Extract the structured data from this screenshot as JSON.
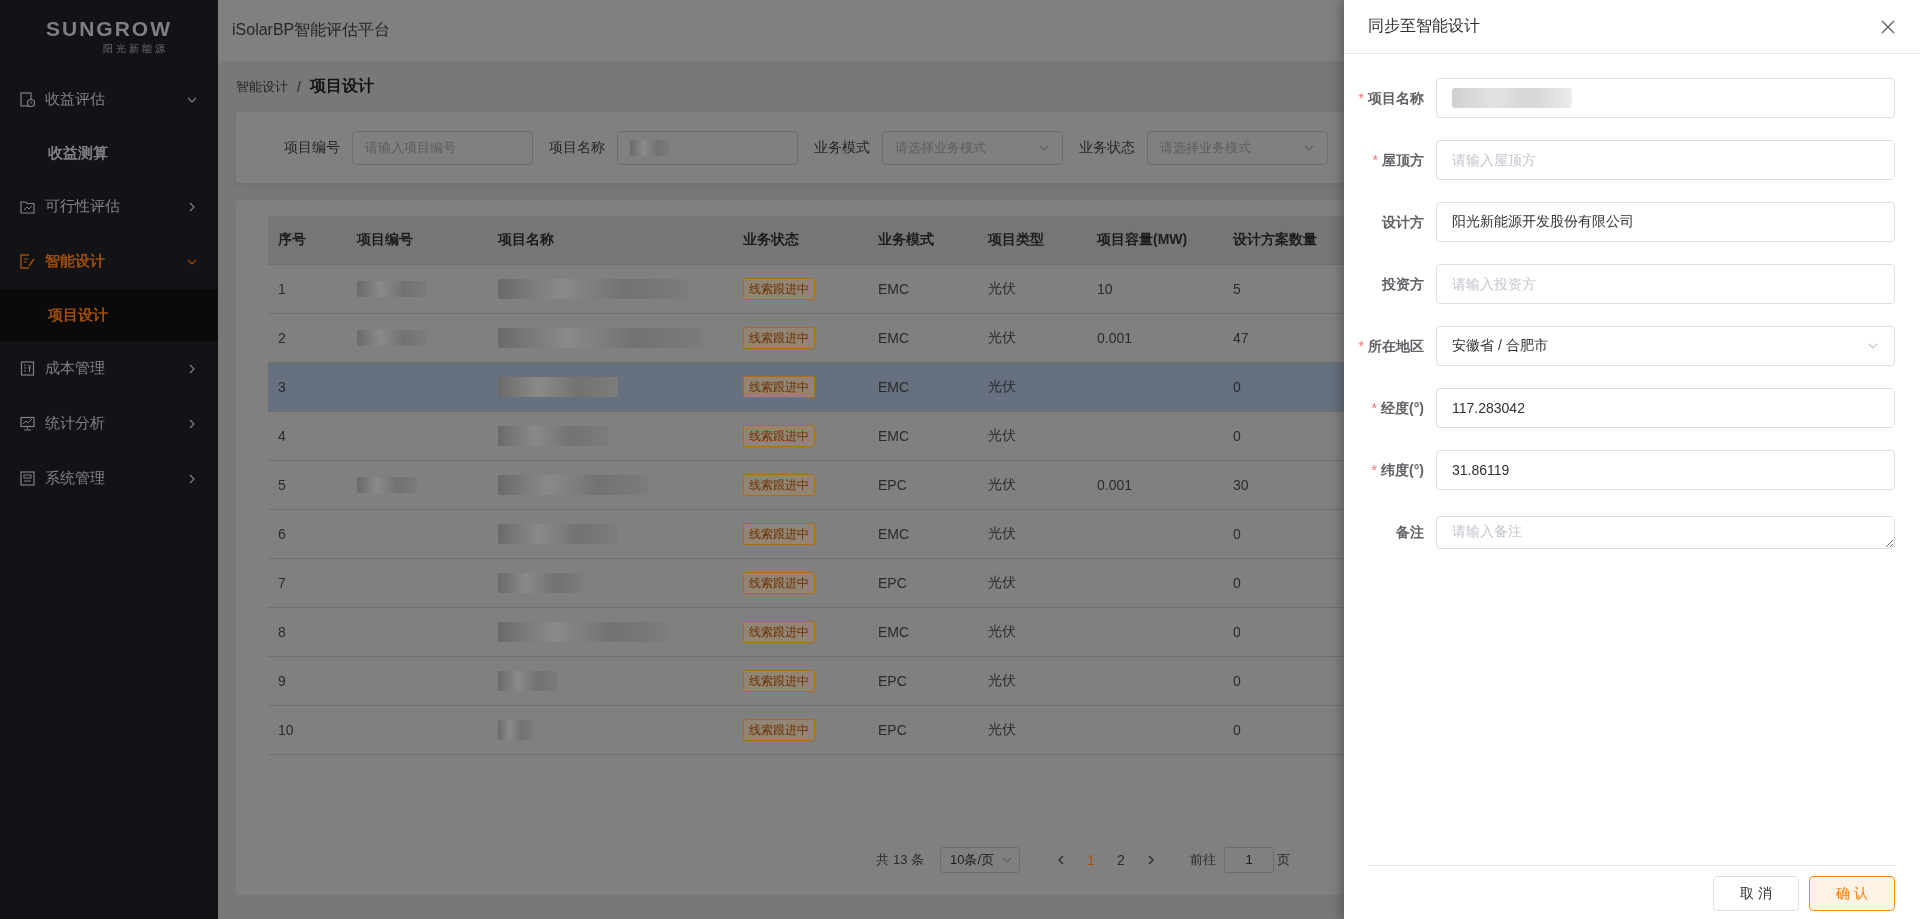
{
  "app": {
    "logo": "SUNGROW",
    "logo_subtitle": "阳光新能源",
    "title": "iSolarBP智能评估平台"
  },
  "sidebar": {
    "items": [
      {
        "label": "收益评估",
        "expanded": true,
        "selected": false,
        "children": [
          {
            "label": "收益测算",
            "selected": false
          }
        ]
      },
      {
        "label": "可行性评估",
        "expanded": false,
        "selected": false
      },
      {
        "label": "智能设计",
        "expanded": true,
        "selected": true,
        "children": [
          {
            "label": "项目设计",
            "selected": true
          }
        ]
      },
      {
        "label": "成本管理",
        "expanded": false,
        "selected": false
      },
      {
        "label": "统计分析",
        "expanded": false,
        "selected": false
      },
      {
        "label": "系统管理",
        "expanded": false,
        "selected": false
      }
    ]
  },
  "breadcrumb": {
    "items": [
      "智能设计",
      "项目设计"
    ],
    "separator": "/"
  },
  "filters": [
    {
      "label": "项目编号",
      "kind": "input",
      "placeholder": "请输入项目编号",
      "redacted": false
    },
    {
      "label": "项目名称",
      "kind": "input",
      "redacted": true
    },
    {
      "label": "业务模式",
      "kind": "select",
      "placeholder": "请选择业务模式",
      "redacted": false
    },
    {
      "label": "业务状态",
      "kind": "select",
      "placeholder": "请选择业务模式",
      "redacted": false
    }
  ],
  "table": {
    "columns": [
      "序号",
      "项目编号",
      "项目名称",
      "业务状态",
      "业务模式",
      "项目类型",
      "项目容量(MW)",
      "设计方案数量"
    ],
    "rows": [
      {
        "no": "1",
        "code_redacted": true,
        "name_redacted": true,
        "status": "线索跟进中",
        "mode": "EMC",
        "type": "光伏",
        "capacity": "10",
        "plans": "5",
        "highlighted": false
      },
      {
        "no": "2",
        "code_redacted": true,
        "name_redacted": true,
        "status": "线索跟进中",
        "mode": "EMC",
        "type": "光伏",
        "capacity": "0.001",
        "plans": "47",
        "highlighted": false
      },
      {
        "no": "3",
        "code_redacted": false,
        "name_redacted": true,
        "status": "线索跟进中",
        "mode": "EMC",
        "type": "光伏",
        "plans": "0",
        "highlighted": true
      },
      {
        "no": "4",
        "code_redacted": false,
        "name_redacted": true,
        "status": "线索跟进中",
        "mode": "EMC",
        "type": "光伏",
        "plans": "0",
        "highlighted": false
      },
      {
        "no": "5",
        "code_redacted": true,
        "name_redacted": true,
        "status": "线索跟进中",
        "mode": "EPC",
        "type": "光伏",
        "capacity": "0.001",
        "plans": "30",
        "highlighted": false
      },
      {
        "no": "6",
        "code_redacted": false,
        "name_redacted": true,
        "status": "线索跟进中",
        "mode": "EMC",
        "type": "光伏",
        "plans": "0",
        "highlighted": false
      },
      {
        "no": "7",
        "code_redacted": false,
        "name_redacted": true,
        "status": "线索跟进中",
        "mode": "EPC",
        "type": "光伏",
        "plans": "0",
        "highlighted": false
      },
      {
        "no": "8",
        "code_redacted": false,
        "name_redacted": true,
        "status": "线索跟进中",
        "mode": "EMC",
        "type": "光伏",
        "plans": "0",
        "highlighted": false
      },
      {
        "no": "9",
        "code_redacted": false,
        "name_redacted": true,
        "status": "线索跟进中",
        "mode": "EPC",
        "type": "光伏",
        "plans": "0",
        "highlighted": false
      },
      {
        "no": "10",
        "code_redacted": false,
        "name_redacted": true,
        "status": "线索跟进中",
        "mode": "EPC",
        "type": "光伏",
        "plans": "0",
        "highlighted": false
      }
    ]
  },
  "pagination": {
    "total": "共 13 条",
    "page_size": "10条/页",
    "pages": [
      {
        "label": "1",
        "selected": true
      },
      {
        "label": "2",
        "selected": false
      }
    ],
    "goto_label": "前往",
    "goto_value": "1",
    "goto_suffix": "页"
  },
  "drawer": {
    "title": "同步至智能设计",
    "required_mark": "*",
    "fields": [
      {
        "label": "项目名称",
        "required": true,
        "kind": "input",
        "redacted": true
      },
      {
        "label": "屋顶方",
        "required": true,
        "kind": "input",
        "placeholder": "请输入屋顶方"
      },
      {
        "label": "设计方",
        "required": false,
        "kind": "input",
        "value": "阳光新能源开发股份有限公司"
      },
      {
        "label": "投资方",
        "required": false,
        "kind": "input",
        "placeholder": "请输入投资方"
      },
      {
        "label": "所在地区",
        "required": true,
        "kind": "select",
        "value": "安徽省 / 合肥市"
      },
      {
        "label": "经度(°)",
        "required": true,
        "kind": "input",
        "value": "117.283042"
      },
      {
        "label": "纬度(°)",
        "required": true,
        "kind": "input",
        "value": "31.86119"
      },
      {
        "label": "备注",
        "required": false,
        "kind": "textarea",
        "placeholder": "请输入备注"
      }
    ],
    "buttons": [
      {
        "label": "取 消",
        "kind": "default"
      },
      {
        "label": "确 认",
        "kind": "primary"
      }
    ]
  }
}
